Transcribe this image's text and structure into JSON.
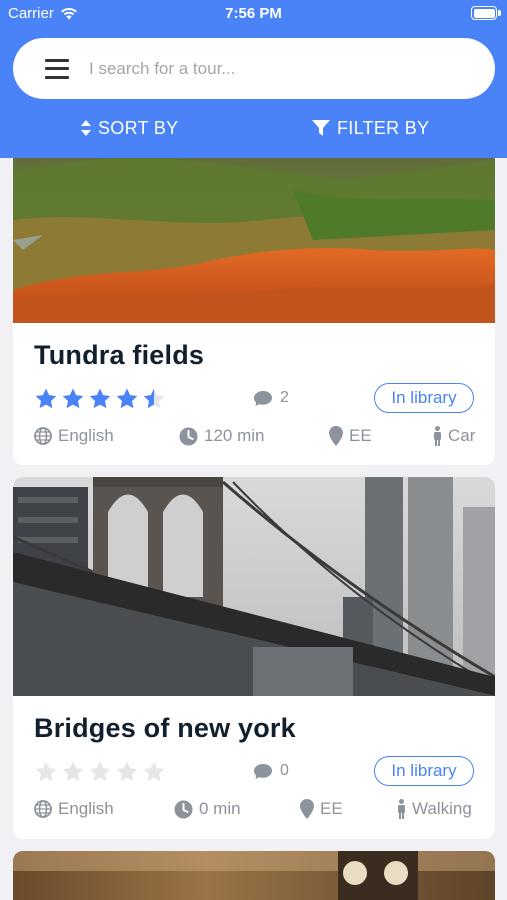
{
  "status_bar": {
    "carrier": "Carrier",
    "time": "7:56 PM"
  },
  "search": {
    "placeholder": "I search for a tour..."
  },
  "toolbar": {
    "sort_label": "SORT BY",
    "filter_label": "FILTER BY"
  },
  "colors": {
    "accent": "#4a82f7",
    "star_filled": "#4a82f7",
    "star_empty": "#e6e6e6",
    "meta_gray": "#8d939c"
  },
  "tours": [
    {
      "title": "Tundra fields",
      "rating": 4.5,
      "rating_max": 5,
      "comments": "2",
      "library_label": "In library",
      "language": "English",
      "duration": "120 min",
      "location": "EE",
      "transport": "Car"
    },
    {
      "title": "Bridges of new york",
      "rating": 0,
      "rating_max": 5,
      "comments": "0",
      "library_label": "In library",
      "language": "English",
      "duration": "0 min",
      "location": "EE",
      "transport": "Walking"
    }
  ]
}
